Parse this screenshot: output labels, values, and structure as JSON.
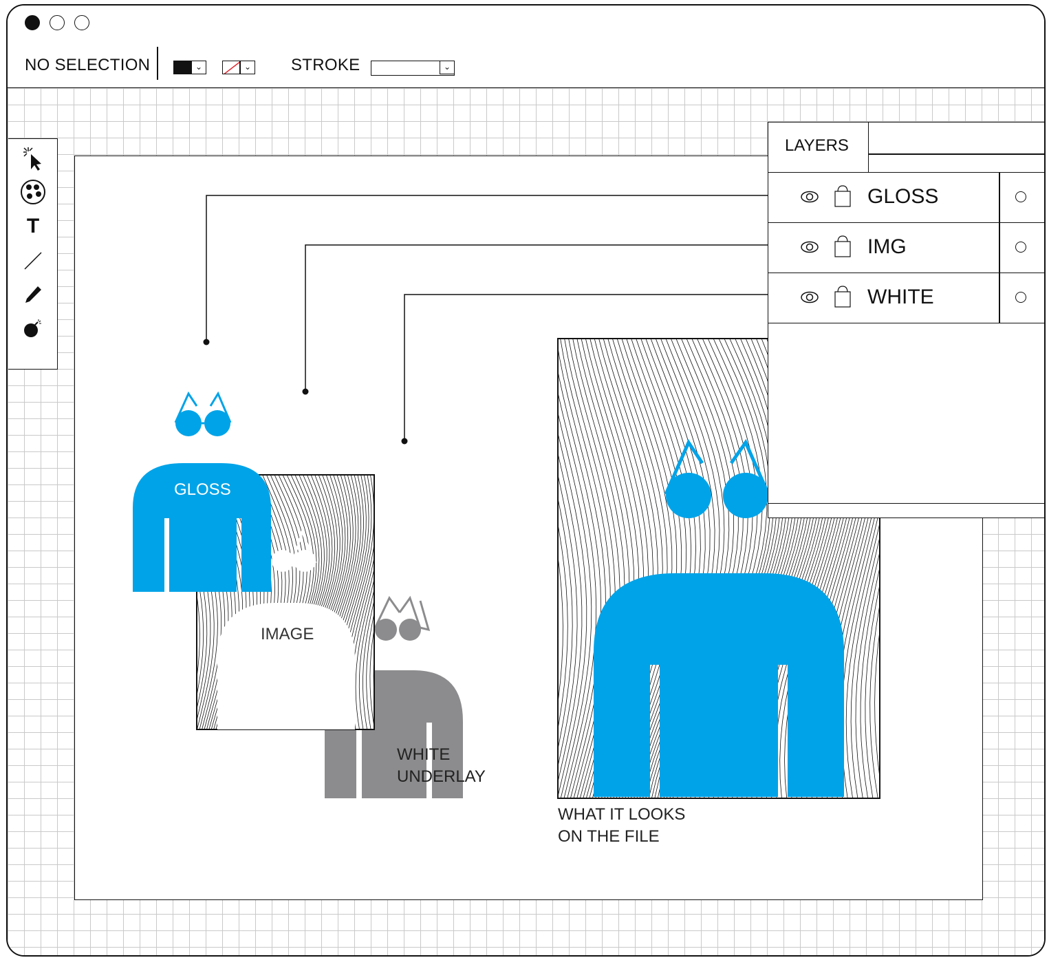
{
  "window": {
    "buttons": [
      "close",
      "minimize",
      "maximize"
    ]
  },
  "toolbar": {
    "selection_label": "NO SELECTION",
    "fill_color": "#000000",
    "stroke_color": "none",
    "stroke_label": "STROKE",
    "stroke_value": ""
  },
  "tools": [
    {
      "name": "selection-tool",
      "icon": "arrow-pointer-icon"
    },
    {
      "name": "swatches-tool",
      "icon": "palette-icon"
    },
    {
      "name": "type-tool",
      "icon": "text-T-icon",
      "glyph": "T"
    },
    {
      "name": "line-tool",
      "icon": "line-icon"
    },
    {
      "name": "pen-tool",
      "icon": "pen-icon"
    },
    {
      "name": "bomb-tool",
      "icon": "bomb-icon"
    }
  ],
  "layers_panel": {
    "tab_label": "LAYERS",
    "layers": [
      {
        "name": "GLOSS",
        "visible": true,
        "locked": false
      },
      {
        "name": "IMG",
        "visible": true,
        "locked": false
      },
      {
        "name": "WHITE",
        "visible": true,
        "locked": false
      }
    ]
  },
  "artwork": {
    "gloss_label": "GLOSS",
    "image_label": "IMAGE",
    "white_label_line1": "WHITE",
    "white_label_line2": "UNDERLAY",
    "result_label_line1": "WHAT IT LOOKS",
    "result_label_line2": "ON THE FILE"
  },
  "colors": {
    "accent": "#00A3E8",
    "underlay_gray": "#8C8C8E",
    "ink": "#111111",
    "grid": "#C9C9C9"
  }
}
